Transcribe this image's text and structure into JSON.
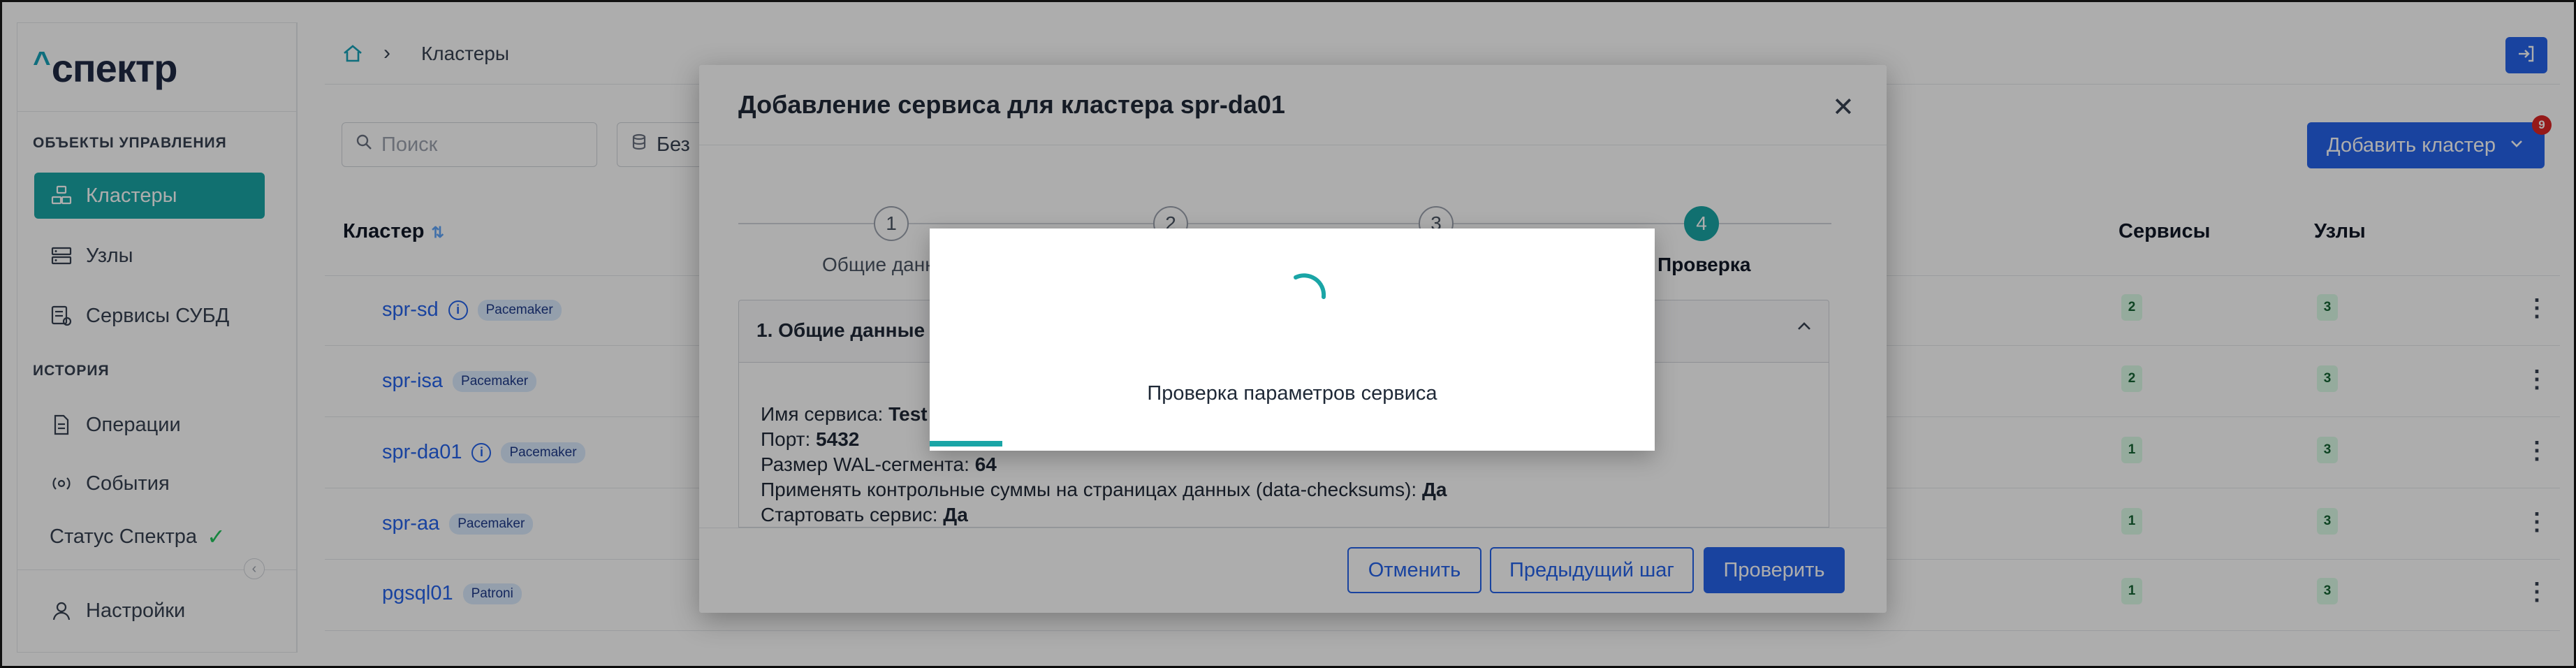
{
  "app": {
    "logo": "спектр",
    "logo_caret": "^"
  },
  "sidebar": {
    "section_objects": "ОБЪЕКТЫ УПРАВЛЕНИЯ",
    "items": [
      {
        "label": "Кластеры",
        "icon": "clusters-icon",
        "active": true
      },
      {
        "label": "Узлы",
        "icon": "nodes-icon",
        "active": false
      },
      {
        "label": "Сервисы СУБД",
        "icon": "db-services-icon",
        "active": false
      }
    ],
    "section_history": "ИСТОРИЯ",
    "history_items": [
      {
        "label": "Операции",
        "icon": "document-icon"
      },
      {
        "label": "События",
        "icon": "events-icon"
      }
    ],
    "status_label": "Статус Спектра",
    "settings_label": "Настройки"
  },
  "breadcrumb": {
    "current": "Кластеры"
  },
  "toolbar": {
    "search_placeholder": "Поиск",
    "filter_label": "Без",
    "add_cluster_label": "Добавить кластер",
    "notification_count": "9"
  },
  "table": {
    "headers": {
      "cluster": "Кластер",
      "services": "Сервисы",
      "nodes": "Узлы"
    },
    "rows": [
      {
        "name": "spr-sd",
        "info": true,
        "tag": "Pacemaker",
        "services": "2",
        "nodes": "3"
      },
      {
        "name": "spr-isa",
        "info": false,
        "tag": "Pacemaker",
        "services": "2",
        "nodes": "3"
      },
      {
        "name": "spr-da01",
        "info": true,
        "tag": "Pacemaker",
        "services": "1",
        "nodes": "3"
      },
      {
        "name": "spr-aa",
        "info": false,
        "tag": "Pacemaker",
        "services": "1",
        "nodes": "3"
      },
      {
        "name": "pgsql01",
        "info": false,
        "tag": "Patroni",
        "services": "1",
        "nodes": "3"
      }
    ]
  },
  "modal": {
    "title": "Добавление сервиса для кластера spr-da01",
    "steps": [
      {
        "num": "1",
        "label": "Общие данн"
      },
      {
        "num": "2",
        "label": ""
      },
      {
        "num": "3",
        "label": ""
      },
      {
        "num": "4",
        "label": "Проверка"
      }
    ],
    "accordion_title": "1. Общие данные",
    "fields": [
      {
        "key": "Имя сервиса: ",
        "value": "Test"
      },
      {
        "key": "Порт: ",
        "value": "5432"
      },
      {
        "key": "Размер WAL-сегмента: ",
        "value": "64"
      },
      {
        "key": "Применять контрольные суммы на страницах данных (data-checksums): ",
        "value": "Да"
      },
      {
        "key": "Стартовать сервис: ",
        "value": "Да"
      }
    ],
    "cancel_label": "Отменить",
    "prev_label": "Предыдущий шаг",
    "check_label": "Проверить"
  },
  "loader": {
    "text": "Проверка параметров сервиса",
    "progress": 0.1
  },
  "colors": {
    "accent": "#1aa5a6",
    "primary": "#2563eb",
    "notification": "#dc2626"
  }
}
